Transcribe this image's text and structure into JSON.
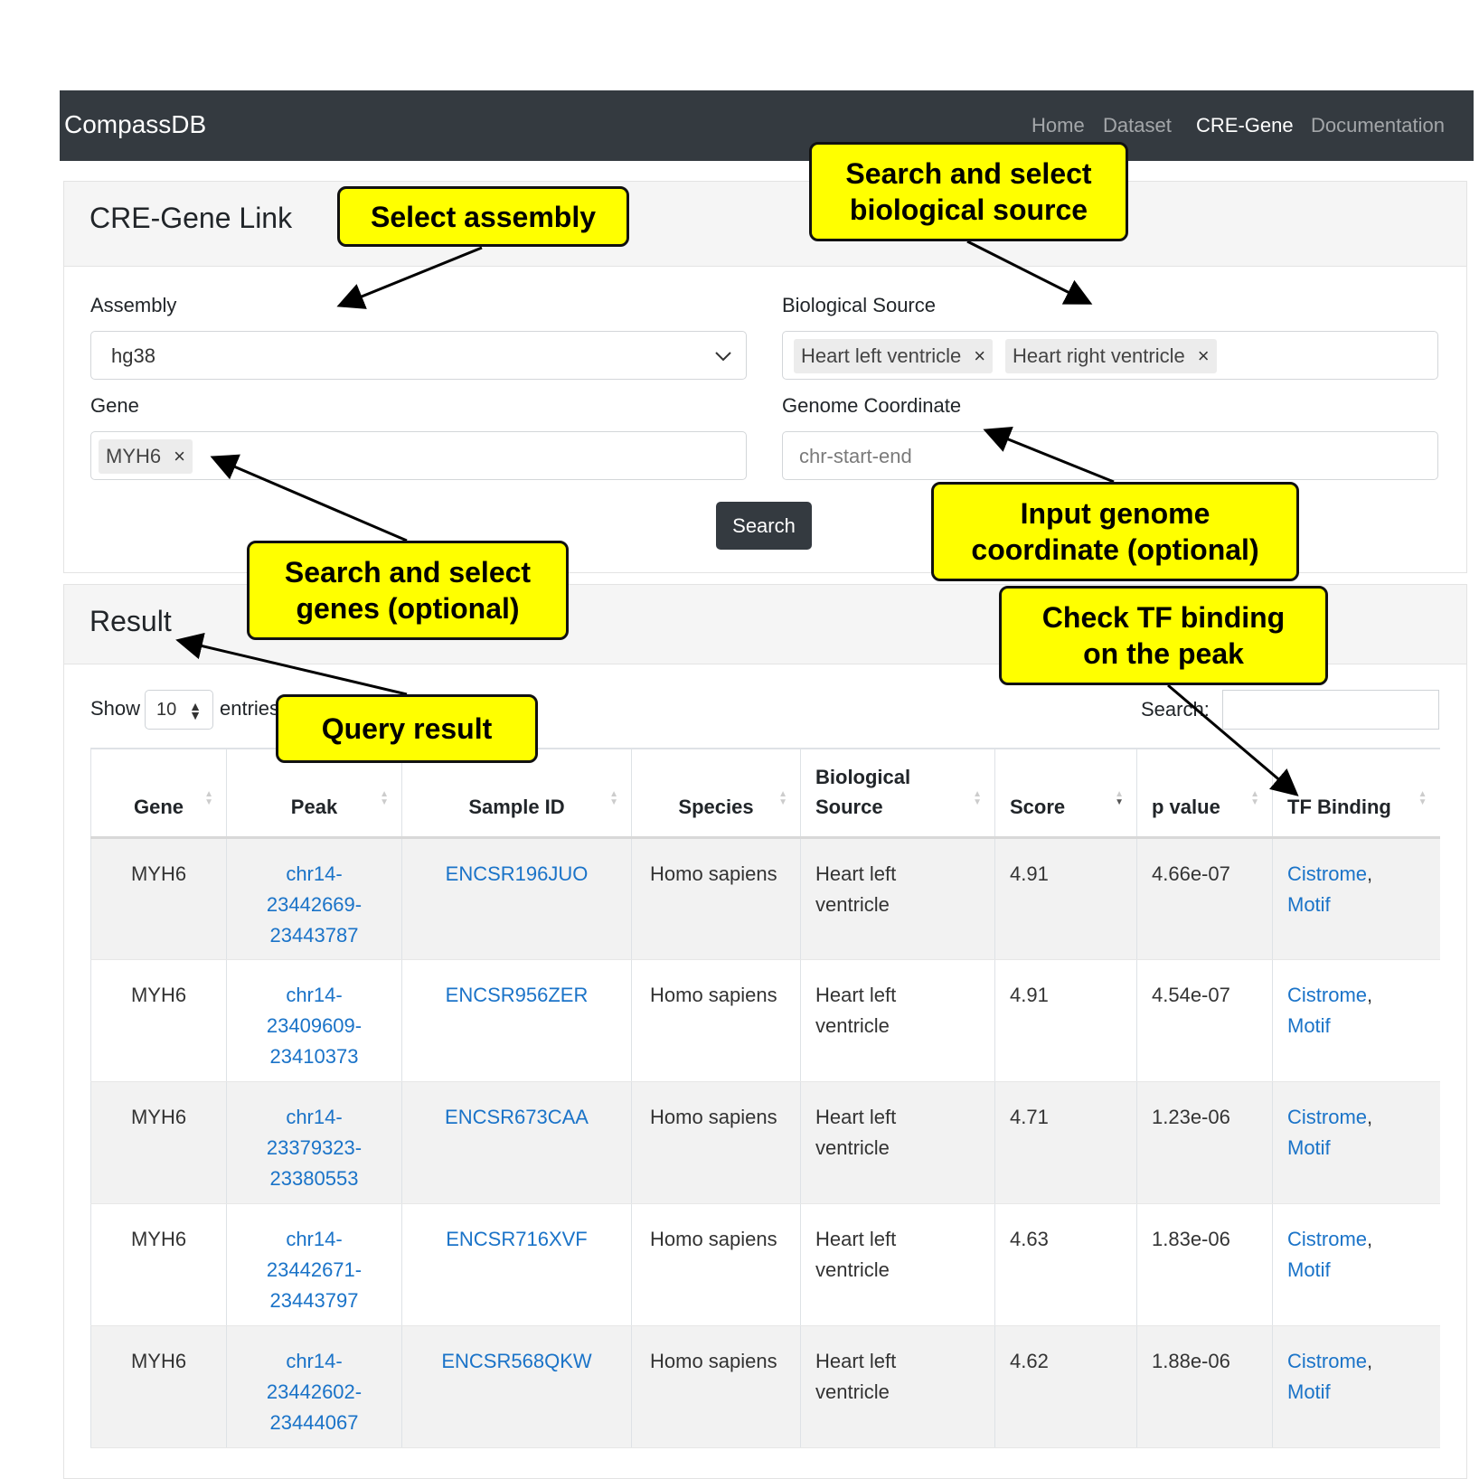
{
  "navbar": {
    "brand": "CompassDB",
    "links": [
      {
        "label": "Home",
        "active": false
      },
      {
        "label": "Dataset",
        "active": false
      },
      {
        "label": "CRE-Gene",
        "active": true
      },
      {
        "label": "Documentation",
        "active": false
      }
    ]
  },
  "query_card": {
    "title": "CRE-Gene Link",
    "assembly": {
      "label": "Assembly",
      "value": "hg38"
    },
    "biological_source": {
      "label": "Biological Source",
      "tags": [
        "Heart left ventricle",
        "Heart right ventricle"
      ],
      "remove_symbol": "×"
    },
    "gene": {
      "label": "Gene",
      "tags": [
        "MYH6"
      ],
      "remove_symbol": "×"
    },
    "genome_coordinate": {
      "label": "Genome Coordinate",
      "placeholder": "chr-start-end",
      "value": ""
    },
    "search_button": "Search"
  },
  "result_card": {
    "title": "Result",
    "length_menu": {
      "prefix": "Show",
      "value": "10",
      "suffix": "entries"
    },
    "search_label": "Search:",
    "columns": [
      "Gene",
      "Peak",
      "Sample ID",
      "Species",
      "Biological Source",
      "Score",
      "p value",
      "TF Binding"
    ],
    "sorted_column": "Score",
    "rows": [
      {
        "gene": "MYH6",
        "peak": [
          "chr14-",
          "23442669-",
          "23443787"
        ],
        "sample_id": "ENCSR196JUO",
        "species": "Homo sapiens",
        "bio_source": [
          "Heart left",
          "ventricle"
        ],
        "score": "4.91",
        "p_value": "4.66e-07",
        "tf_binding": [
          "Cistrome",
          "Motif"
        ]
      },
      {
        "gene": "MYH6",
        "peak": [
          "chr14-",
          "23409609-",
          "23410373"
        ],
        "sample_id": "ENCSR956ZER",
        "species": "Homo sapiens",
        "bio_source": [
          "Heart left",
          "ventricle"
        ],
        "score": "4.91",
        "p_value": "4.54e-07",
        "tf_binding": [
          "Cistrome",
          "Motif"
        ]
      },
      {
        "gene": "MYH6",
        "peak": [
          "chr14-",
          "23379323-",
          "23380553"
        ],
        "sample_id": "ENCSR673CAA",
        "species": "Homo sapiens",
        "bio_source": [
          "Heart left",
          "ventricle"
        ],
        "score": "4.71",
        "p_value": "1.23e-06",
        "tf_binding": [
          "Cistrome",
          "Motif"
        ]
      },
      {
        "gene": "MYH6",
        "peak": [
          "chr14-",
          "23442671-",
          "23443797"
        ],
        "sample_id": "ENCSR716XVF",
        "species": "Homo sapiens",
        "bio_source": [
          "Heart left",
          "ventricle"
        ],
        "score": "4.63",
        "p_value": "1.83e-06",
        "tf_binding": [
          "Cistrome",
          "Motif"
        ]
      },
      {
        "gene": "MYH6",
        "peak": [
          "chr14-",
          "23442602-",
          "23444067"
        ],
        "sample_id": "ENCSR568QKW",
        "species": "Homo sapiens",
        "bio_source": [
          "Heart left",
          "ventricle"
        ],
        "score": "4.62",
        "p_value": "1.88e-06",
        "tf_binding": [
          "Cistrome",
          "Motif"
        ]
      }
    ]
  },
  "callouts": {
    "select_assembly": "Select assembly",
    "search_bio_source": [
      "Search and select",
      "biological source"
    ],
    "search_genes": [
      "Search and select",
      "genes (optional)"
    ],
    "input_coordinate": [
      "Input genome",
      "coordinate (optional)"
    ],
    "check_tf": [
      "Check TF binding",
      "on the peak"
    ],
    "query_result": "Query result"
  },
  "colors": {
    "navbar": "#343a40",
    "callout": "#ffff00",
    "link": "#1a73c8"
  }
}
